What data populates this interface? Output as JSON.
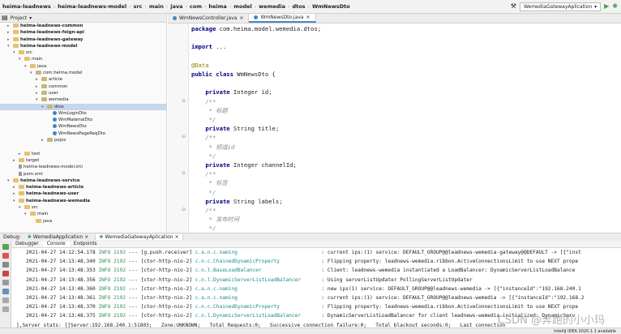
{
  "nav": {
    "crumbs": [
      "heima-leadnews",
      "heima-leadnews-model",
      "src",
      "main",
      "java",
      "com",
      "heima",
      "model",
      "wemedia",
      "dtos",
      "WmNewsDto"
    ],
    "run_config": "WemediaGatewayAplication"
  },
  "project": {
    "header": "Project",
    "tree": [
      {
        "label": "heima-leadnews-common",
        "indent": 1,
        "arrow": "▸",
        "icon": "folder",
        "bold": true
      },
      {
        "label": "heima-leadnews-feign-api",
        "indent": 1,
        "arrow": "▸",
        "icon": "folder",
        "bold": true
      },
      {
        "label": "heima-leadnews-gateway",
        "indent": 1,
        "arrow": "▸",
        "icon": "folder",
        "bold": true
      },
      {
        "label": "heima-leadnews-model",
        "indent": 1,
        "arrow": "▾",
        "icon": "folder",
        "bold": true
      },
      {
        "label": "src",
        "indent": 2,
        "arrow": "▾",
        "icon": "folder"
      },
      {
        "label": "main",
        "indent": 3,
        "arrow": "▾",
        "icon": "folder"
      },
      {
        "label": "java",
        "indent": 4,
        "arrow": "▾",
        "icon": "folder"
      },
      {
        "label": "com.heima.model",
        "indent": 5,
        "arrow": "▾",
        "icon": "pkg"
      },
      {
        "label": "article",
        "indent": 6,
        "arrow": "▸",
        "icon": "pkg"
      },
      {
        "label": "common",
        "indent": 6,
        "arrow": "▸",
        "icon": "pkg"
      },
      {
        "label": "user",
        "indent": 6,
        "arrow": "▸",
        "icon": "pkg"
      },
      {
        "label": "wemedia",
        "indent": 6,
        "arrow": "▾",
        "icon": "pkg"
      },
      {
        "label": "dtos",
        "indent": 7,
        "arrow": "▾",
        "icon": "pkg",
        "selected": true
      },
      {
        "label": "WmLoginDto",
        "indent": 8,
        "arrow": "",
        "icon": "cls"
      },
      {
        "label": "WmMaterialDto",
        "indent": 8,
        "arrow": "",
        "icon": "cls"
      },
      {
        "label": "WmNewsDto",
        "indent": 8,
        "arrow": "",
        "icon": "cls"
      },
      {
        "label": "WmNewsPageReqDto",
        "indent": 8,
        "arrow": "",
        "icon": "cls"
      },
      {
        "label": "pojos",
        "indent": 7,
        "arrow": "▸",
        "icon": "pkg"
      },
      {
        "label": "",
        "indent": 0,
        "arrow": "",
        "icon": ""
      },
      {
        "label": "test",
        "indent": 3,
        "arrow": "▸",
        "icon": "folder"
      },
      {
        "label": "target",
        "indent": 2,
        "arrow": "▸",
        "icon": "folder"
      },
      {
        "label": "heima-leadnews-model.iml",
        "indent": 2,
        "arrow": "",
        "icon": "file"
      },
      {
        "label": "pom.xml",
        "indent": 2,
        "arrow": "",
        "icon": "file"
      },
      {
        "label": "heima-leadnews-service",
        "indent": 1,
        "arrow": "▾",
        "icon": "folder",
        "bold": true
      },
      {
        "label": "heima-leadnews-article",
        "indent": 2,
        "arrow": "▸",
        "icon": "folder",
        "bold": true
      },
      {
        "label": "heima-leadnews-user",
        "indent": 2,
        "arrow": "▸",
        "icon": "folder",
        "bold": true
      },
      {
        "label": "heima-leadnews-wemedia",
        "indent": 2,
        "arrow": "▾",
        "icon": "folder",
        "bold": true
      },
      {
        "label": "src",
        "indent": 3,
        "arrow": "▾",
        "icon": "folder"
      },
      {
        "label": "main",
        "indent": 4,
        "arrow": "▾",
        "icon": "folder"
      },
      {
        "label": "java",
        "indent": 5,
        "arrow": "",
        "icon": "folder"
      }
    ]
  },
  "editor": {
    "tabs": [
      "WmNewsController.java",
      "WmNewsDto.java"
    ],
    "lines": [
      {
        "text": "package com.heima.model.wemedia.dtos;",
        "kind": "pkg"
      },
      {
        "text": "",
        "kind": "plain"
      },
      {
        "text": "import ...",
        "kind": "import"
      },
      {
        "text": "",
        "kind": "plain"
      },
      {
        "text": "@Data",
        "kind": "ann"
      },
      {
        "text": "public class WmNewsDto {",
        "kind": "classdecl"
      },
      {
        "text": "",
        "kind": "plain"
      },
      {
        "text": "    private Integer id;",
        "kind": "field"
      },
      {
        "text": "    /**",
        "kind": "cm"
      },
      {
        "text": "     * 标题",
        "kind": "cm"
      },
      {
        "text": "     */",
        "kind": "cm"
      },
      {
        "text": "    private String title;",
        "kind": "field"
      },
      {
        "text": "    /**",
        "kind": "cm"
      },
      {
        "text": "     * 频道id",
        "kind": "cm"
      },
      {
        "text": "     */",
        "kind": "cm"
      },
      {
        "text": "    private Integer channelId;",
        "kind": "field"
      },
      {
        "text": "    /**",
        "kind": "cm"
      },
      {
        "text": "     * 标签",
        "kind": "cm"
      },
      {
        "text": "     */",
        "kind": "cm"
      },
      {
        "text": "    private String labels;",
        "kind": "field"
      },
      {
        "text": "    /**",
        "kind": "cm"
      },
      {
        "text": "     * 发布时间",
        "kind": "cm"
      },
      {
        "text": "     */",
        "kind": "cm"
      }
    ]
  },
  "debug": {
    "label": "Debug:",
    "tabs": [
      "WemediaApplication",
      "WemediaGatewayAplication"
    ],
    "sub_tabs": [
      "Debugger",
      "Console",
      "Endpoints"
    ]
  },
  "console": {
    "lines": [
      {
        "ts": "2021-04-27 14:12:54.178",
        "level": "INFO",
        "pid": "2192",
        "thread": "[g.push.receiver]",
        "logger": "c.a.n.c.naming",
        "msg": ": current ips:(1) service: DEFAULT_GROUP@@leadnews-wemedia-gateway@@DEFAULT -> [{\"inst"
      },
      {
        "ts": "2021-04-27 14:13:48.340",
        "level": "INFO",
        "pid": "2192",
        "thread": "[ctor-http-nio-2]",
        "logger": "c.n.c.ChainedDynamicProperty",
        "msg": ": Flipping property: leadnews-wemedia.ribbon.ActiveConnectionsLimit to use NEXT prope"
      },
      {
        "ts": "2021-04-27 14:13:48.353",
        "level": "INFO",
        "pid": "2192",
        "thread": "[ctor-http-nio-2]",
        "logger": "c.n.l.BaseLoadBalancer",
        "msg": ": Client: leadnews-wemedia instantiated a LoadBalancer: DynamicServerListLoadBalance"
      },
      {
        "ts": "2021-04-27 14:13:48.356",
        "level": "INFO",
        "pid": "2192",
        "thread": "[ctor-http-nio-2]",
        "logger": "c.n.l.DynamicServerListLoadBalancer",
        "msg": ": Using serverListUpdater PollingServerListUpdater"
      },
      {
        "ts": "2021-04-27 14:13:48.360",
        "level": "INFO",
        "pid": "2192",
        "thread": "[ctor-http-nio-2]",
        "logger": "c.a.n.c.naming",
        "msg": ": new ips(1) service: DEFAULT_GROUP@@leadnews-wemedia -> [{\"instanceId\":\"192.168.240.1"
      },
      {
        "ts": "2021-04-27 14:13:48.361",
        "level": "INFO",
        "pid": "2192",
        "thread": "[ctor-http-nio-2]",
        "logger": "c.a.n.c.naming",
        "msg": ": current ips:(1) service: DEFAULT_GROUP@@leadnews-wemedia -> [{\"instanceId\":\"192.168.2"
      },
      {
        "ts": "2021-04-27 14:13:48.370",
        "level": "INFO",
        "pid": "2192",
        "thread": "[ctor-http-nio-2]",
        "logger": "c.n.c.ChainedDynamicProperty",
        "msg": ": Flipping property: leadnews-wemedia.ribbon.ActiveConnectionsLimit to use NEXT prope"
      },
      {
        "ts": "2021-04-27 14:13:48.375",
        "level": "INFO",
        "pid": "2192",
        "thread": "[ctor-http-nio-2]",
        "logger": "c.n.l.DynamicServerListLoadBalancer",
        "msg": ": DynamicServerListLoadBalancer for client leadnews-wemedia initialized: DynamicServ"
      }
    ],
    "stats_line": "],Server stats: [[Server:192.168.240.1:51803;   Zone:UNKNOWN;   Total Requests:0;   Successive connection failure:0;   Total blackout seconds:0;   Last connection"
  },
  "status_bar": "IntelliJ IDEA 2020.1.1 available",
  "watermark": "CSDN @奔跑的小小玛",
  "colors": {
    "accent": "#4a88c7",
    "info": "#2e8b57",
    "logger": "#1d8c8c",
    "keyword": "#000080"
  }
}
